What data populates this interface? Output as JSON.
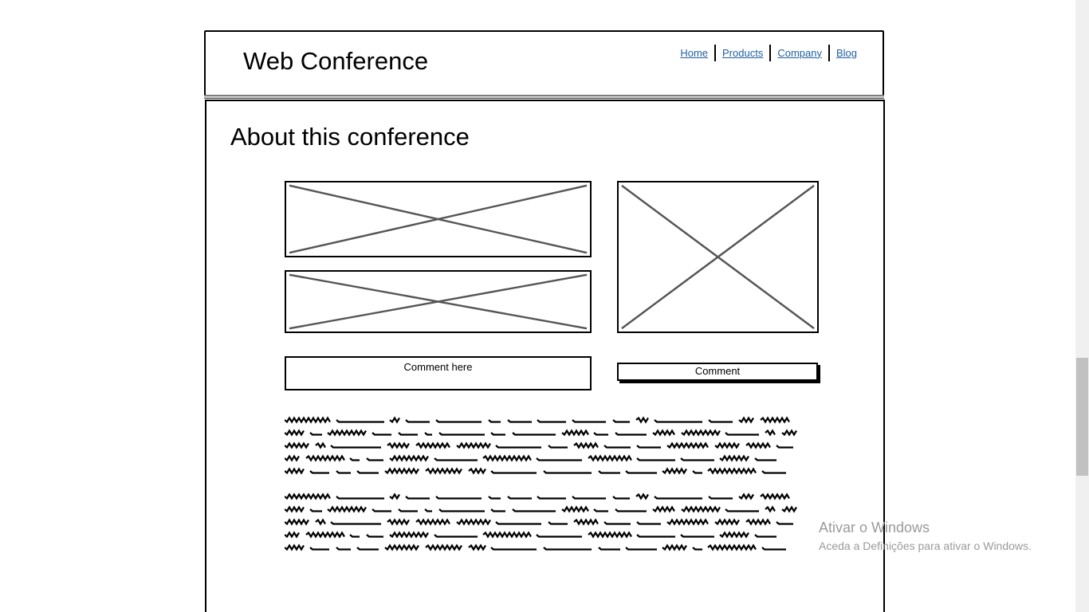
{
  "header": {
    "site_title": "Web Conference",
    "nav": [
      "Home",
      "Products",
      "Company",
      "Blog"
    ]
  },
  "main": {
    "heading": "About this conference",
    "comment_placeholder": "Comment here",
    "comment_button": "Comment"
  },
  "watermark": {
    "title": "Ativar o Windows",
    "subtitle": "Aceda a Definições para ativar o Windows."
  },
  "colors": {
    "link": "#1f5fa3",
    "placeholder_cross": "#555555",
    "watermark": "#9a9a9a"
  }
}
